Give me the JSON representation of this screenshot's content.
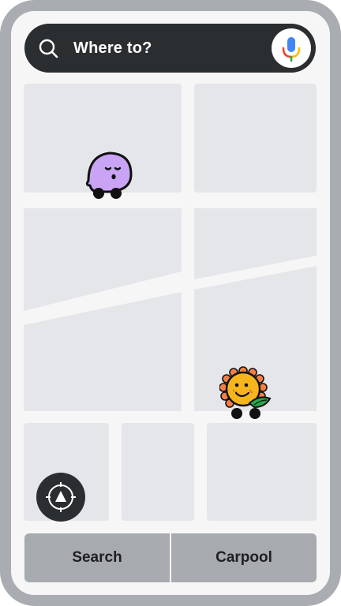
{
  "search": {
    "placeholder": "Where to?"
  },
  "icons": {
    "search": "search-icon",
    "mic": "microphone-icon",
    "recenter": "recenter-compass-icon",
    "wazer_purple": "purple-wazer-avatar",
    "wazer_sunflower": "sunflower-wazer-avatar"
  },
  "bottom_bar": {
    "search_label": "Search",
    "carpool_label": "Carpool"
  },
  "colors": {
    "frame": "#a9acb0",
    "map_background": "#f6f6f7",
    "map_block": "#e5e6e9",
    "search_bar": "#2b2e31",
    "bottom_button": "#a7aaaf",
    "purple_wazer": "#c9a4f5",
    "sunflower_face": "#f7b51d",
    "sunflower_petals": "#f47f45"
  }
}
